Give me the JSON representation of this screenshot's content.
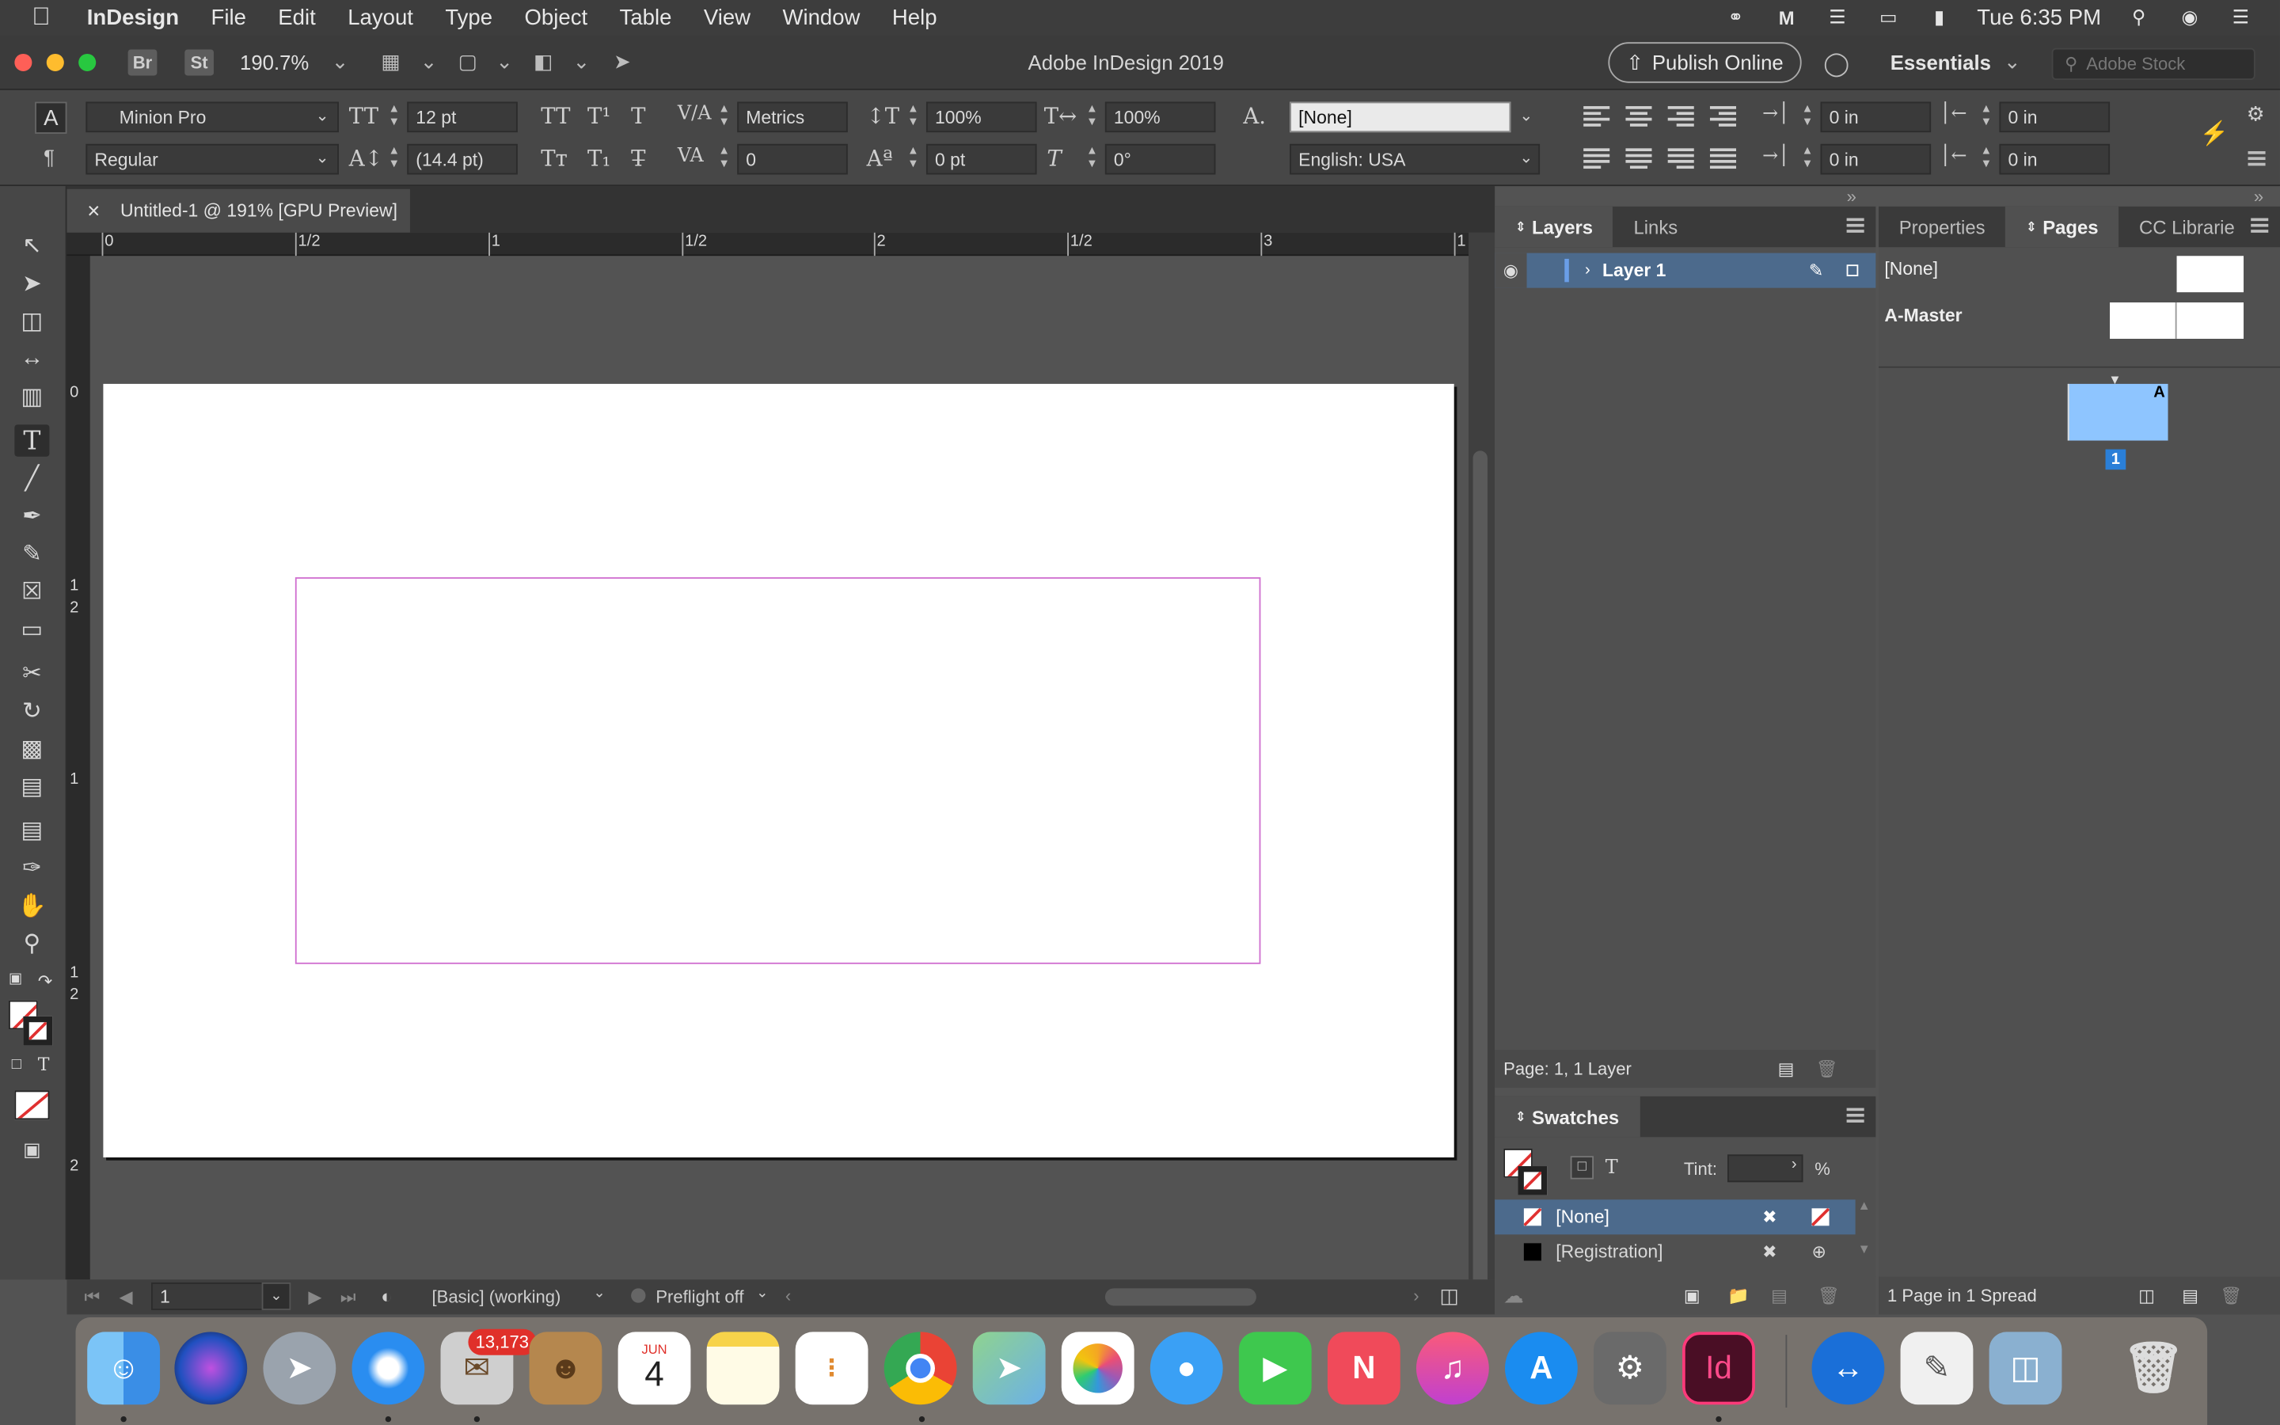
{
  "menubar": {
    "app_name": "InDesign",
    "items": [
      "File",
      "Edit",
      "Layout",
      "Type",
      "Object",
      "Table",
      "View",
      "Window",
      "Help"
    ],
    "clock": "Tue 6:35 PM"
  },
  "appbar": {
    "bridge": "Br",
    "stock_short": "St",
    "zoom": "190.7%",
    "title": "Adobe InDesign 2019",
    "publish_label": "Publish Online",
    "workspace": "Essentials",
    "stock_placeholder": "Adobe Stock"
  },
  "control": {
    "font_family": "Minion Pro",
    "font_style": "Regular",
    "font_size": "12 pt",
    "leading": "(14.4 pt)",
    "kerning": "Metrics",
    "tracking": "0",
    "vscale": "100%",
    "hscale": "100%",
    "baseline": "0 pt",
    "skew": "0°",
    "char_style": "[None]",
    "language": "English: USA",
    "left_indent": "0 in",
    "right_indent": "0 in",
    "first_indent": "0 in",
    "last_indent": "0 in"
  },
  "document": {
    "tab_label": "Untitled-1 @ 191% [GPU Preview]",
    "close_glyph": "×"
  },
  "ruler": {
    "h_labels": [
      "0",
      "1/2",
      "1",
      "1/2",
      "2",
      "1/2",
      "3",
      "1"
    ],
    "v_labels": [
      "0",
      "1",
      "2",
      "1",
      "1",
      "2",
      "2"
    ]
  },
  "status": {
    "page": "1",
    "style": "[Basic] (working)",
    "preflight": "Preflight off"
  },
  "layers_panel": {
    "tabs": [
      "Layers",
      "Links"
    ],
    "layer_name": "Layer 1",
    "footer": "Page: 1, 1 Layer"
  },
  "pages_panel": {
    "tabs": [
      "Properties",
      "Pages",
      "CC Librarie"
    ],
    "none_label": "[None]",
    "master_label": "A-Master",
    "page_number": "1",
    "page_badge": "A",
    "footer": "1 Page in 1 Spread"
  },
  "swatches_panel": {
    "tab": "Swatches",
    "tint_label": "Tint:",
    "tint_unit": "%",
    "items": [
      "[None]",
      "[Registration]"
    ]
  },
  "dock": {
    "mail_badge": "13,173",
    "calendar_month": "JUN",
    "calendar_day": "4",
    "indesign_label": "Id"
  },
  "colors": {
    "accent": "#4c6a8c",
    "frame_guide": "#d070d0",
    "page_thumb": "#8ec5ff"
  }
}
